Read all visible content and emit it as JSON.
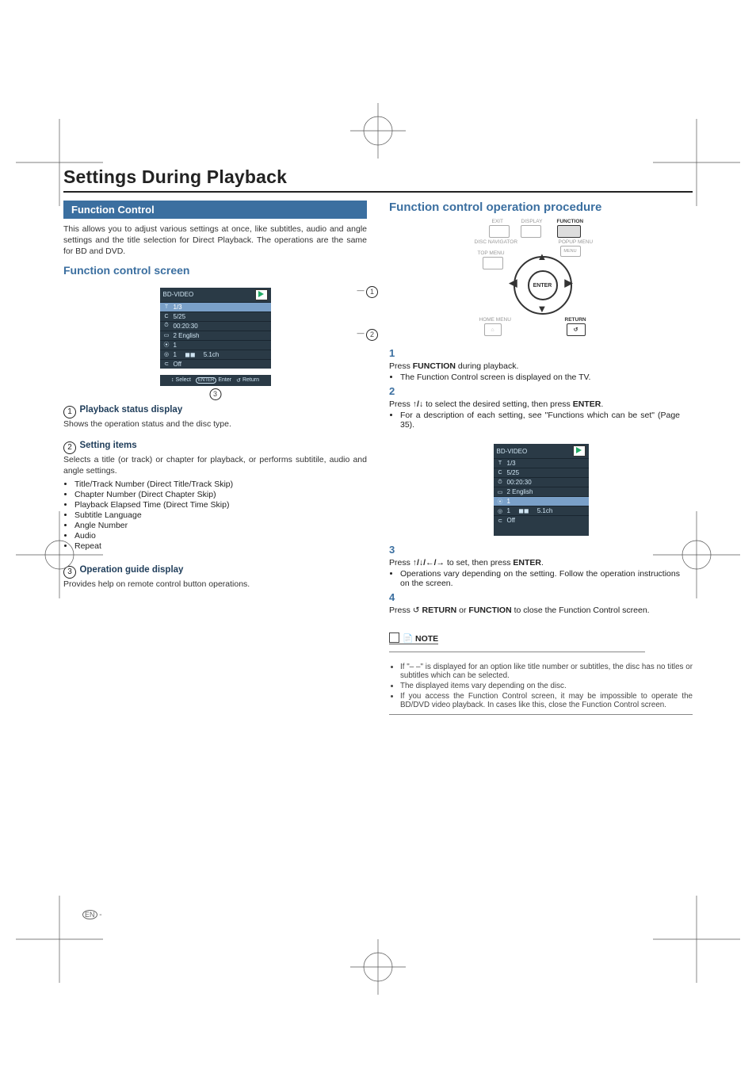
{
  "page": {
    "title": "Settings During Playback"
  },
  "left": {
    "header": "Function Control",
    "intro": "This allows you to adjust various settings at once, like subtitles, audio and angle settings and the title selection for Direct Playback. The operations are the same for BD and DVD.",
    "screen_heading": "Function control screen",
    "osd": {
      "title": "BD-VIDEO",
      "rows": {
        "title_track": "1/3",
        "chapter": "5/25",
        "time": "00:20:30",
        "subtitle": "2 English",
        "angle": "1",
        "audio_num": "1",
        "audio_fmt": "5.1ch",
        "audio_icon": "◼◼",
        "repeat": "Off"
      },
      "guide": {
        "select": "Select",
        "enter": "Enter",
        "return": "Return"
      }
    },
    "sec1": {
      "num": "1",
      "title": "Playback status display",
      "body": "Shows the operation status and the disc type."
    },
    "sec2": {
      "num": "2",
      "title": "Setting items",
      "body": "Selects a title (or track) or chapter for playback, or performs subtitile, audio and angle settings.",
      "items": [
        "Title/Track Number (Direct Title/Track Skip)",
        "Chapter Number (Direct Chapter Skip)",
        "Playback Elapsed Time (Direct Time Skip)",
        "Subtitle Language",
        "Angle Number",
        "Audio",
        "Repeat"
      ]
    },
    "sec3": {
      "num": "3",
      "title": "Operation guide display",
      "body": "Provides help on remote control button operations."
    }
  },
  "right": {
    "header": "Function control operation procedure",
    "remote": {
      "exit": "EXIT",
      "display": "DISPLAY",
      "function": "FUNCTION",
      "disc_nav": "DISC NAVIGATOR",
      "top_menu": "TOP MENU",
      "popup": "POPUP MENU",
      "menu": "MENU",
      "enter": "ENTER",
      "home": "HOME MENU",
      "return": "RETURN"
    },
    "steps": {
      "s1": {
        "num": "1",
        "a": "Press ",
        "bold1": "FUNCTION",
        "b": " during playback.",
        "sub": "The Function Control screen is displayed on the TV."
      },
      "s2": {
        "num": "2",
        "a": "Press ",
        "arrows": "↕",
        "b": " to select the desired setting, then press ",
        "bold1": "ENTER",
        "c": ".",
        "sub": "For a description of each setting, see \"Functions which can be set\" (Page 35)."
      },
      "s3": {
        "num": "3",
        "a": "Press ",
        "arrows": "↕/↔",
        "b": " to set, then press ",
        "bold1": "ENTER",
        "c": ".",
        "sub": "Operations vary depending on the setting. Follow the operation instructions on the screen."
      },
      "s4": {
        "num": "4",
        "a": "Press ",
        "ret_icon": "↺",
        "bold1": "RETURN",
        "b": " or ",
        "bold2": "FUNCTION",
        "c": " to close the Function Control screen."
      }
    },
    "osd2": {
      "title": "BD-VIDEO",
      "rows": {
        "title_track": "1/3",
        "chapter": "5/25",
        "time": "00:20:30",
        "subtitle": "2 English",
        "angle": "1",
        "audio_num": "1",
        "audio_fmt": "5.1ch",
        "audio_icon": "◼◼",
        "repeat": "Off"
      }
    },
    "note": {
      "label": "NOTE",
      "items": [
        "If \"– –\" is displayed for an option like title number or subtitles, the disc has no titles or subtitles which can be selected.",
        "The displayed items vary depending on the disc.",
        "If you access the Function Control screen, it may be impossible to operate the BD/DVD video playback. In cases like this, close the Function Control screen."
      ]
    }
  },
  "footer": {
    "en": "EN",
    "dash": " -"
  }
}
